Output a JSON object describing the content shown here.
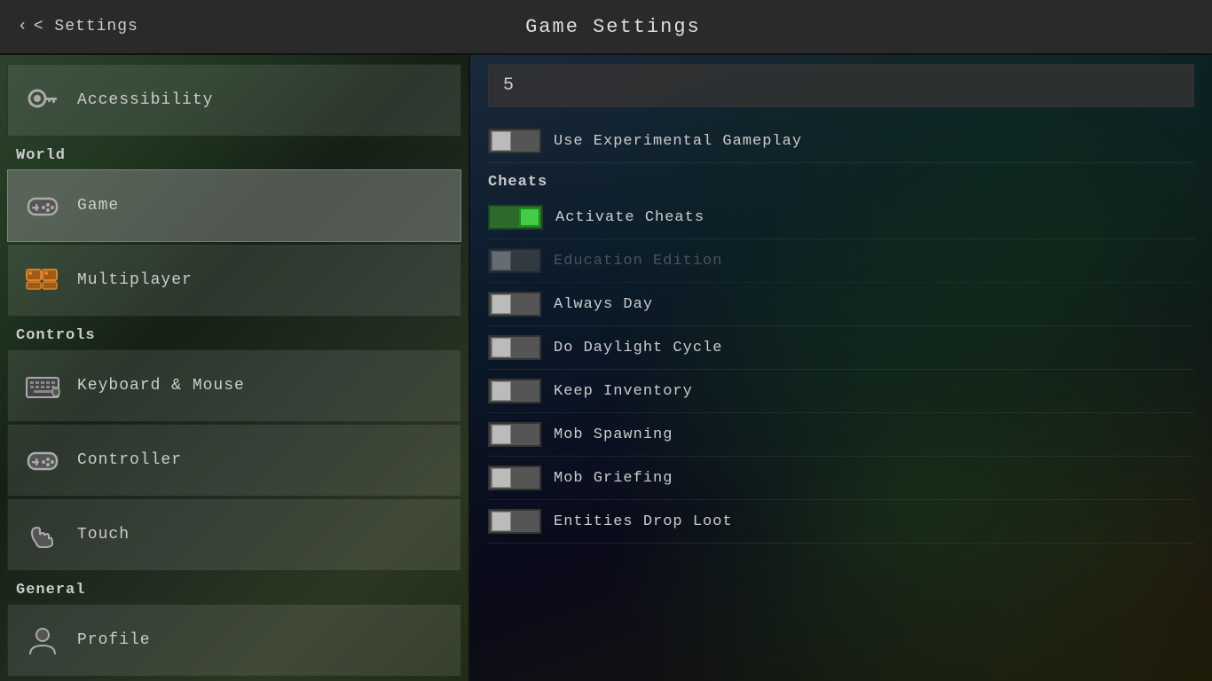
{
  "header": {
    "back_label": "< Settings",
    "title": "Game Settings"
  },
  "sidebar": {
    "sections": [
      {
        "label": "",
        "items": [
          {
            "id": "accessibility",
            "label": "Accessibility",
            "icon": "key"
          }
        ]
      },
      {
        "label": "World",
        "items": [
          {
            "id": "game",
            "label": "Game",
            "icon": "controller",
            "active": true
          },
          {
            "id": "multiplayer",
            "label": "Multiplayer",
            "icon": "multiplayer"
          }
        ]
      },
      {
        "label": "Controls",
        "items": [
          {
            "id": "keyboard",
            "label": "Keyboard & Mouse",
            "icon": "keyboard"
          },
          {
            "id": "controller",
            "label": "Controller",
            "icon": "controller2"
          },
          {
            "id": "touch",
            "label": "Touch",
            "icon": "touch"
          }
        ]
      },
      {
        "label": "General",
        "items": [
          {
            "id": "profile",
            "label": "Profile",
            "icon": "profile"
          }
        ]
      }
    ]
  },
  "right_panel": {
    "number_value": "5",
    "toggles": [
      {
        "id": "experimental",
        "label": "Use Experimental Gameplay",
        "state": "off",
        "enabled": true
      },
      {
        "id": "cheats_header",
        "label": "Cheats",
        "is_header": true
      },
      {
        "id": "activate_cheats",
        "label": "Activate Cheats",
        "state": "on",
        "enabled": true
      },
      {
        "id": "education",
        "label": "Education Edition",
        "state": "off",
        "enabled": false
      },
      {
        "id": "always_day",
        "label": "Always Day",
        "state": "off",
        "enabled": true
      },
      {
        "id": "daylight_cycle",
        "label": "Do Daylight Cycle",
        "state": "off",
        "enabled": true
      },
      {
        "id": "keep_inventory",
        "label": "Keep Inventory",
        "state": "off",
        "enabled": true
      },
      {
        "id": "mob_spawning",
        "label": "Mob Spawning",
        "state": "off",
        "enabled": true
      },
      {
        "id": "mob_griefing",
        "label": "Mob Griefing",
        "state": "off",
        "enabled": true
      },
      {
        "id": "entities_drop_loot",
        "label": "Entities Drop Loot",
        "state": "off",
        "enabled": true
      }
    ]
  }
}
